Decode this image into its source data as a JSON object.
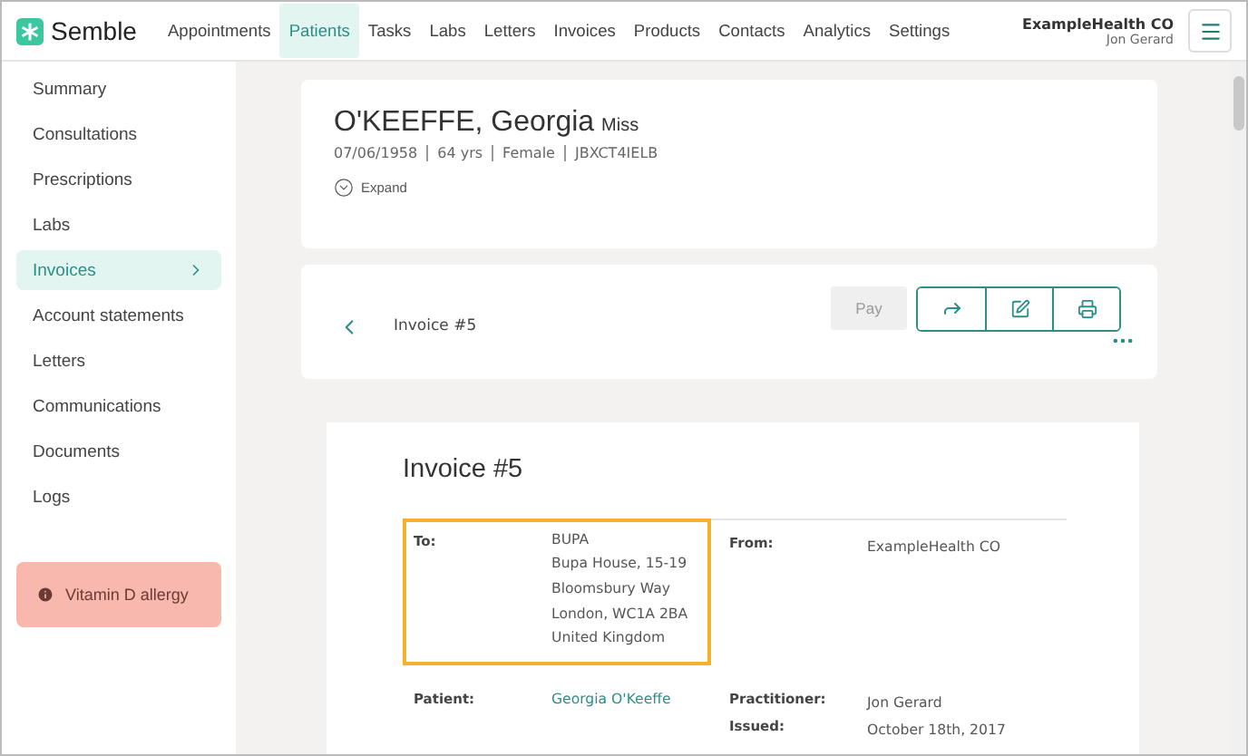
{
  "brand": {
    "name": "Semble"
  },
  "nav": [
    {
      "label": "Appointments",
      "selected": false
    },
    {
      "label": "Patients",
      "selected": true
    },
    {
      "label": "Tasks",
      "selected": false
    },
    {
      "label": "Labs",
      "selected": false
    },
    {
      "label": "Letters",
      "selected": false
    },
    {
      "label": "Invoices",
      "selected": false
    },
    {
      "label": "Products",
      "selected": false
    },
    {
      "label": "Contacts",
      "selected": false
    },
    {
      "label": "Analytics",
      "selected": false
    },
    {
      "label": "Settings",
      "selected": false
    }
  ],
  "account": {
    "organisation": "ExampleHealth CO",
    "user": "Jon Gerard"
  },
  "sidebar": {
    "items": [
      {
        "label": "Summary",
        "selected": false
      },
      {
        "label": "Consultations",
        "selected": false
      },
      {
        "label": "Prescriptions",
        "selected": false
      },
      {
        "label": "Labs",
        "selected": false
      },
      {
        "label": "Invoices",
        "selected": true
      },
      {
        "label": "Account statements",
        "selected": false
      },
      {
        "label": "Letters",
        "selected": false
      },
      {
        "label": "Communications",
        "selected": false
      },
      {
        "label": "Documents",
        "selected": false
      },
      {
        "label": "Logs",
        "selected": false
      }
    ],
    "alert": "Vitamin D allergy"
  },
  "patient": {
    "name": "O'KEEFFE, Georgia",
    "title": "Miss",
    "details": [
      "07/06/1958",
      "64 yrs",
      "Female",
      "JBXCT4IELB"
    ],
    "expand": "Expand"
  },
  "toolbar": {
    "title": "Invoice #5",
    "pay": {
      "label": "Pay",
      "disabled": true
    }
  },
  "invoice": {
    "heading": "Invoice #5",
    "to": {
      "label": "To:",
      "lines": [
        "BUPA",
        "Bupa House, 15-19",
        "Bloomsbury Way",
        "London, WC1A 2BA",
        "United Kingdom"
      ],
      "highlighted": true
    },
    "from": {
      "label": "From:",
      "value": "ExampleHealth CO"
    },
    "patient": {
      "label": "Patient:",
      "value": "Georgia O'Keeffe"
    },
    "practitioner": {
      "label": "Practitioner:",
      "value": "Jon Gerard"
    },
    "issued": {
      "label": "Issued:",
      "value": "October 18th, 2017"
    }
  }
}
